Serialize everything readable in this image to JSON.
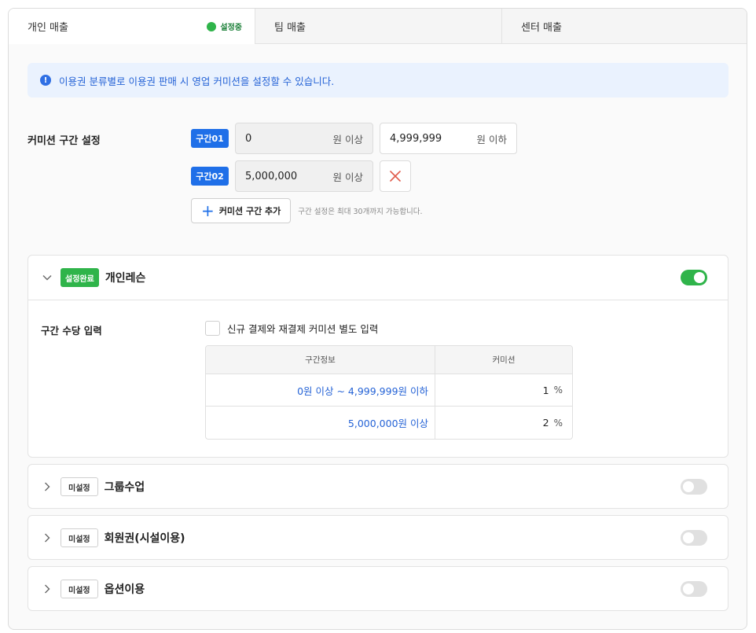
{
  "tabs": [
    {
      "label": "개인 매출",
      "status": "설정중"
    },
    {
      "label": "팀 매출"
    },
    {
      "label": "센터 매출"
    }
  ],
  "notice": {
    "icon": "info-icon",
    "text": "이용권 분류별로 이용권 판매 시 영업 커미션을 설정할 수 있습니다."
  },
  "range": {
    "label": "커미션 구간 설정",
    "rows": [
      {
        "badge": "구간01",
        "from": "0",
        "from_unit": "원 이상",
        "to": "4,999,999",
        "to_unit": "원 이하"
      },
      {
        "badge": "구간02",
        "from": "5,000,000",
        "from_unit": "원 이상"
      }
    ],
    "add_button": "커미션 구간 추가",
    "hint": "구간 설정은 최대 30개까지 가능합니다."
  },
  "sections": [
    {
      "status": "설정완료",
      "title": "개인레슨",
      "expanded": true,
      "enabled": true,
      "input_label": "구간 수당 입력",
      "checkbox_label": "신규 결제와 재결제 커미션 별도 입력",
      "table": {
        "headers": [
          "구간정보",
          "커미션"
        ],
        "rows": [
          {
            "range": "0원 이상 ~ 4,999,999원 이하",
            "value": "1",
            "unit": "%"
          },
          {
            "range": "5,000,000원 이상",
            "value": "2",
            "unit": "%"
          }
        ]
      }
    },
    {
      "status": "미설정",
      "title": "그룹수업",
      "expanded": false,
      "enabled": false
    },
    {
      "status": "미설정",
      "title": "회원권(시설이용)",
      "expanded": false,
      "enabled": false
    },
    {
      "status": "미설정",
      "title": "옵션이용",
      "expanded": false,
      "enabled": false
    }
  ],
  "colors": {
    "accent": "#1f6fe8",
    "success": "#2fb44a",
    "link": "#2563d6"
  }
}
